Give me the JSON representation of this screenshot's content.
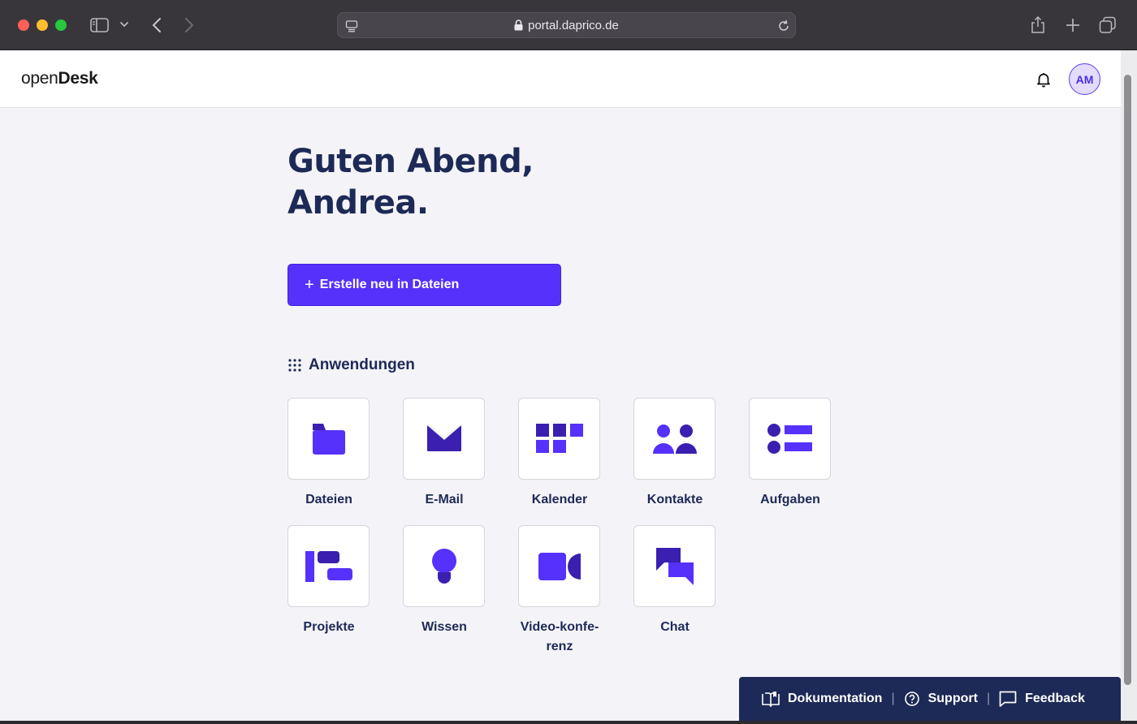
{
  "browser": {
    "url": "portal.daprico.de"
  },
  "header": {
    "logo_light": "open",
    "logo_bold": "Desk",
    "avatar_initials": "AM"
  },
  "greeting": {
    "line1": "Guten Abend,",
    "line2": "Andrea."
  },
  "create_button": {
    "icon": "+",
    "label": "Erstelle neu in Dateien"
  },
  "apps_section": {
    "title": "Anwendungen",
    "items": [
      {
        "label": "Dateien",
        "icon": "folder-icon"
      },
      {
        "label": "E-Mail",
        "icon": "mail-icon"
      },
      {
        "label": "Kalender",
        "icon": "calendar-icon"
      },
      {
        "label": "Kontakte",
        "icon": "contacts-icon"
      },
      {
        "label": "Aufgaben",
        "icon": "tasks-icon"
      },
      {
        "label": "Projekte",
        "icon": "projects-icon"
      },
      {
        "label": "Wissen",
        "icon": "lightbulb-icon"
      },
      {
        "label": "Video-konfe-",
        "label2": "renz",
        "icon": "video-camera-icon"
      },
      {
        "label": "Chat",
        "icon": "chat-icon"
      }
    ]
  },
  "footer": {
    "documentation": "Dokumentation",
    "support": "Support",
    "feedback": "Feedback",
    "separator": "|"
  },
  "colors": {
    "primary": "#5630fb",
    "primary_dark": "#3a1fb0",
    "navy": "#1d2a57",
    "page_bg": "#f4f3f7"
  }
}
